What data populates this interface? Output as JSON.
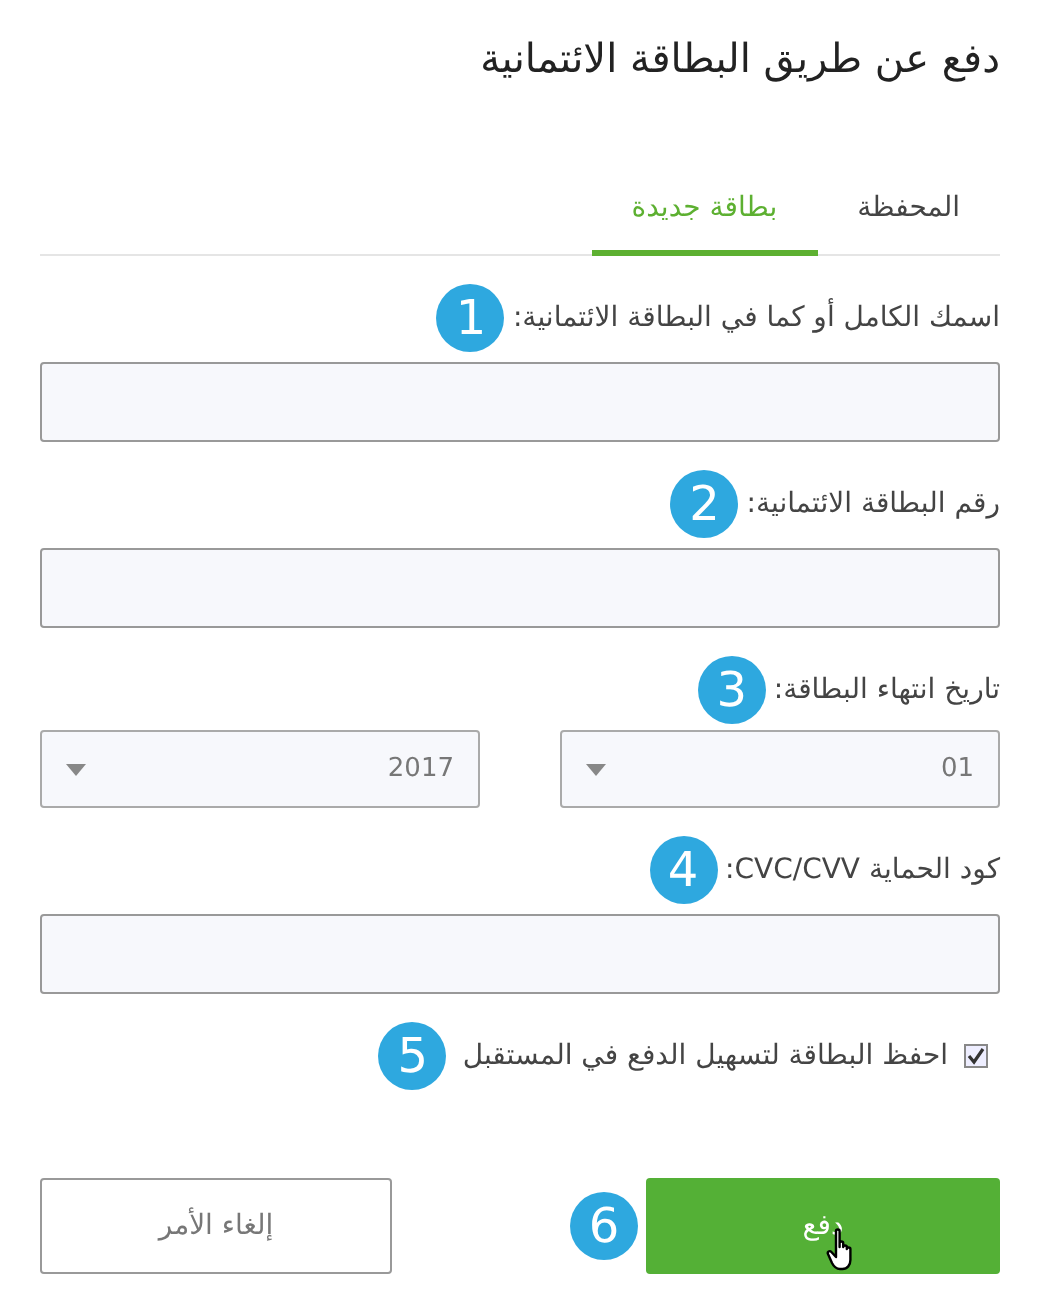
{
  "title": "دفع عن طريق البطاقة الائتمانية",
  "tabs": [
    {
      "label": "المحفظة",
      "selected": false
    },
    {
      "label": "بطاقة جديدة",
      "selected": true
    }
  ],
  "fields": [
    {
      "kind": "text",
      "label": "اسمك الكامل أو كما في البطاقة الائتمانية:",
      "callout": "1"
    },
    {
      "kind": "text",
      "label": "رقم البطاقة الائتمانية:",
      "callout": "2"
    },
    {
      "kind": "selects",
      "label": "تاريخ انتهاء البطاقة:",
      "callout": "3",
      "selects": [
        {
          "value": "01"
        },
        {
          "value": "2017"
        }
      ]
    },
    {
      "kind": "text",
      "label": "كود الحماية CVC/CVV:",
      "callout": "4"
    }
  ],
  "checkbox": {
    "label": "احفظ البطاقة لتسهيل الدفع في المستقبل",
    "checked": true,
    "callout": "5"
  },
  "buttons": [
    {
      "kind": "primary",
      "label": "دفع",
      "callout": "6"
    },
    {
      "kind": "secondary",
      "label": "إلغاء الأمر"
    }
  ]
}
